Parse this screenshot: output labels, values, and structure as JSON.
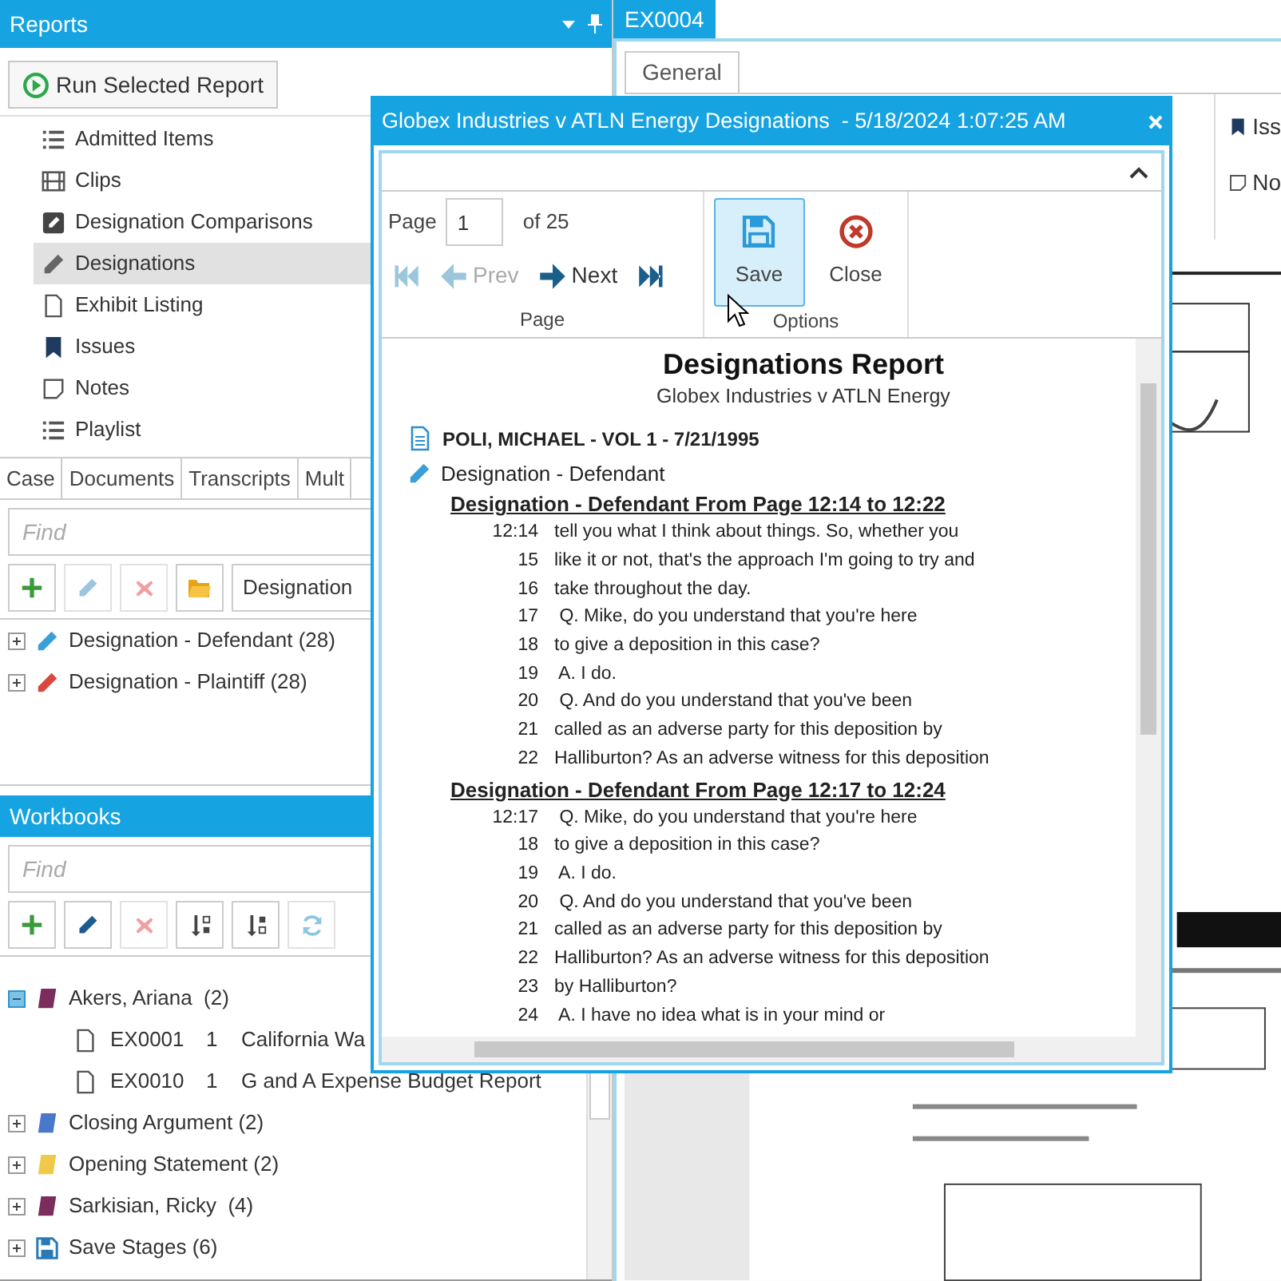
{
  "reports": {
    "title": "Reports",
    "run_button": "Run Selected Report",
    "items": [
      {
        "kind": "list",
        "label": "Admitted Items",
        "selected": false
      },
      {
        "kind": "film",
        "label": "Clips",
        "selected": false
      },
      {
        "kind": "compare",
        "label": "Designation Comparisons",
        "selected": false
      },
      {
        "kind": "pencil",
        "label": "Designations",
        "selected": true
      },
      {
        "kind": "page",
        "label": "Exhibit Listing",
        "selected": false
      },
      {
        "kind": "bookmark",
        "label": "Issues",
        "selected": false
      },
      {
        "kind": "note",
        "label": "Notes",
        "selected": false
      },
      {
        "kind": "list",
        "label": "Playlist",
        "selected": false
      }
    ],
    "tabs": [
      {
        "label": "Case",
        "selected": false
      },
      {
        "label": "Documents",
        "selected": false
      },
      {
        "label": "Transcripts",
        "selected": false
      },
      {
        "label": "Mult",
        "selected": false
      }
    ],
    "find": {
      "placeholder": "Find"
    },
    "toolbar": [
      {
        "kind": "add",
        "disabled": false
      },
      {
        "kind": "edit",
        "disabled": true
      },
      {
        "kind": "delete",
        "disabled": true
      },
      {
        "kind": "folder",
        "disabled": false
      }
    ],
    "filter": "Designation",
    "tree": [
      {
        "label": "Designation - Defendant (28)",
        "color": "#3a9fd8",
        "expanded": false
      },
      {
        "label": "Designation - Plaintiff (28)",
        "color": "#d9473f",
        "expanded": false
      }
    ]
  },
  "workbooks": {
    "title": "Workbooks",
    "find": {
      "placeholder": "Find"
    },
    "toolbar": [
      {
        "kind": "add",
        "disabled": false
      },
      {
        "kind": "edit",
        "disabled": false
      },
      {
        "kind": "delete",
        "disabled": true
      },
      {
        "kind": "sort_az",
        "disabled": false
      },
      {
        "kind": "sort_za",
        "disabled": false
      },
      {
        "kind": "refresh",
        "disabled": true
      }
    ],
    "tree": [
      {
        "kind": "book",
        "label": "Akers, Ariana  (2)",
        "color": "#7b2d5e",
        "expanded": true,
        "children": [
          {
            "exhibit": "EX0001",
            "page": "1",
            "title": "California Wa"
          },
          {
            "exhibit": "EX0010",
            "page": "1",
            "title": "G and A Expense Budget Report"
          }
        ]
      },
      {
        "kind": "book",
        "label": "Closing Argument (2)",
        "color": "#4a78c8",
        "expanded": false
      },
      {
        "kind": "book",
        "label": "Opening Statement (2)",
        "color": "#f0c94a",
        "expanded": false
      },
      {
        "kind": "book",
        "label": "Sarkisian, Ricky  (4)",
        "color": "#7b2d5e",
        "expanded": false
      },
      {
        "kind": "save",
        "label": "Save Stages (6)",
        "color": "#2a7ab8",
        "expanded": false
      }
    ]
  },
  "document": {
    "tab": "EX0004",
    "inner_tab": {
      "label": "General",
      "selected": true
    },
    "side_items": [
      {
        "kind": "bookmark",
        "label": "Iss"
      },
      {
        "kind": "note",
        "label": "No"
      }
    ]
  },
  "dialog": {
    "title": "Globex Industries v ATLN Energy Designations  - 5/18/2024 1:07:25 AM",
    "page_label": "Page",
    "page_value": "1",
    "page_total": "of 25",
    "nav": [
      {
        "kind": "first",
        "disabled": true
      },
      {
        "kind": "prev",
        "label": "Prev",
        "disabled": true
      },
      {
        "kind": "next",
        "label": "Next",
        "disabled": false
      },
      {
        "kind": "last",
        "disabled": false
      }
    ],
    "page_group": "Page",
    "options_group": "Options",
    "buttons": [
      {
        "kind": "save",
        "label": "Save",
        "highlighted": true
      },
      {
        "kind": "close",
        "label": "Close",
        "highlighted": false
      }
    ],
    "report": {
      "title": "Designations Report",
      "subtitle": "Globex Industries v ATLN Energy",
      "deponent": "POLI, MICHAEL - VOL 1 - 7/21/1995",
      "designation": "Designation - Defendant",
      "sections": [
        {
          "heading": "Designation - Defendant From Page 12:14 to 12:22",
          "lines": [
            {
              "num": "12:14",
              "text": "tell you what I think about things. So, whether you"
            },
            {
              "num": "15",
              "text": "like it or not, that's the approach I'm going to try and"
            },
            {
              "num": "16",
              "text": "take throughout the day."
            },
            {
              "num": "17",
              "text": " Q. Mike, do you understand that you're here"
            },
            {
              "num": "18",
              "text": "to give a deposition in this case?"
            },
            {
              "num": "19",
              "text": " A. I do."
            },
            {
              "num": "20",
              "text": " Q. And do you understand that you've been"
            },
            {
              "num": "21",
              "text": "called as an adverse party for this deposition by"
            },
            {
              "num": "22",
              "text": "Halliburton? As an adverse witness for this deposition"
            }
          ]
        },
        {
          "heading": "Designation - Defendant From Page 12:17 to 12:24",
          "lines": [
            {
              "num": "12:17",
              "text": " Q. Mike, do you understand that you're here"
            },
            {
              "num": "18",
              "text": "to give a deposition in this case?"
            },
            {
              "num": "19",
              "text": " A. I do."
            },
            {
              "num": "20",
              "text": " Q. And do you understand that you've been"
            },
            {
              "num": "21",
              "text": "called as an adverse party for this deposition by"
            },
            {
              "num": "22",
              "text": "Halliburton? As an adverse witness for this deposition"
            },
            {
              "num": "23",
              "text": "by Halliburton?"
            },
            {
              "num": "24",
              "text": " A. I have no idea what is in your mind or"
            }
          ]
        }
      ]
    }
  }
}
